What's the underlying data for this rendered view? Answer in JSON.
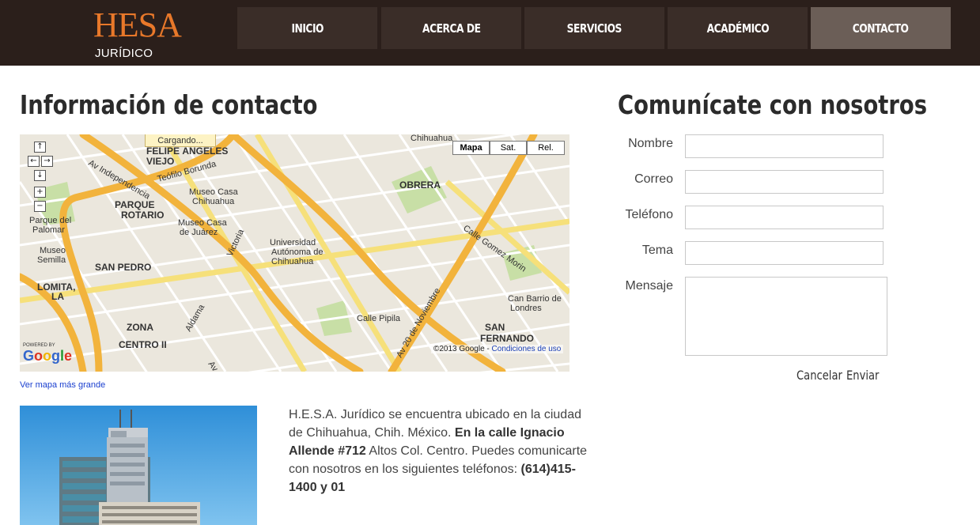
{
  "header": {
    "logo_main": "HESA",
    "logo_sub": "JURÍDICO",
    "nav": [
      {
        "label": "INICIO"
      },
      {
        "label": "ACERCA DE"
      },
      {
        "label": "SERVICIOS"
      },
      {
        "label": "ACADÉMICO"
      },
      {
        "label": "CONTACTO",
        "active": true
      }
    ],
    "colors": {
      "bar": "#2b1f1b",
      "nav": "#3a2d28",
      "nav_active": "#6b5e57",
      "accent": "#e8782a"
    }
  },
  "contact_info": {
    "title": "Información de contacto",
    "map": {
      "loading": "Cargando...",
      "types": [
        "Mapa",
        "Sat.",
        "Rel."
      ],
      "active_type": "Mapa",
      "controls": [
        "↑",
        "←",
        "→",
        "↓",
        "+",
        "−"
      ],
      "powered_by": "POWERED BY",
      "logo": "Google",
      "copyright": "©2013 Google - ",
      "terms": "Condiciones de uso",
      "labels": {
        "av_independencia": "Av Independencia",
        "teofilo": "Teófilo Borunda",
        "felipe": "FELIPE ÁNGELES VIEJO",
        "parque_rotario": "PARQUE ROTARIO",
        "parque_palomar": "Parque del Palomar",
        "museo_semilla": "Museo Semilla",
        "lomita": "LOMITA, LA",
        "san_pedro": "SAN PEDRO",
        "zona_centro": "ZONA CENTRO II",
        "obrera": "OBRERA",
        "san_fernando": "SAN FERNANDO",
        "universidad": "Universidad Autónoma de Chihuahua",
        "museo_casa_chih": "Museo Casa Chihuahua",
        "museo_juarez": "Museo Casa de Juárez",
        "av_20_nov": "Av 20 de Noviembre",
        "gomez_morin": "Calle Gomez Morin",
        "can_barrio": "Can Barrio de Londres",
        "chihuahua": "Chihuahua",
        "victoria": "Victoria",
        "aldama": "Aldama",
        "av_ocampo": "Av Ocampo",
        "calle_pipila": "Calle Pipila"
      }
    },
    "bigger_map_link": "Ver mapa más grande",
    "description": {
      "part1": "H.E.S.A. Jurídico se encuentra ubicado en la ciudad de Chihuahua, Chih. México. ",
      "bold1": "En la calle Ignacio Allende #712",
      "part2": " Altos Col. Centro. Puedes comunicarte con nosotros en los siguientes teléfonos: ",
      "bold2": "(614)415-1400 y 01"
    }
  },
  "form": {
    "title": "Comunícate con nosotros",
    "fields": {
      "nombre": {
        "label": "Nombre",
        "value": ""
      },
      "correo": {
        "label": "Correo",
        "value": ""
      },
      "telefono": {
        "label": "Teléfono",
        "value": ""
      },
      "tema": {
        "label": "Tema",
        "value": ""
      },
      "mensaje": {
        "label": "Mensaje",
        "value": ""
      }
    },
    "cancel_label": "Cancelar",
    "submit_label": "Enviar"
  }
}
